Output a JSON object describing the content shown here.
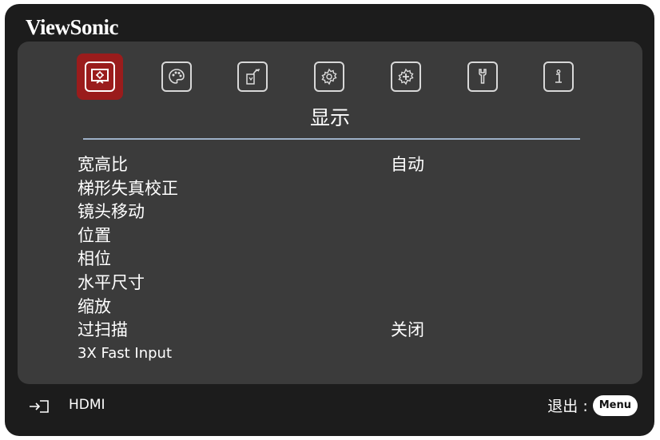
{
  "brand": "ViewSonic",
  "tabs": [
    {
      "icon": "display-icon",
      "selected": true
    },
    {
      "icon": "picture-palette-icon",
      "selected": false
    },
    {
      "icon": "power-management-icon",
      "selected": false
    },
    {
      "icon": "basic-settings-icon",
      "selected": false
    },
    {
      "icon": "advanced-settings-icon",
      "selected": false
    },
    {
      "icon": "system-wrench-icon",
      "selected": false
    },
    {
      "icon": "information-icon",
      "selected": false
    }
  ],
  "active_tab_title": "显示",
  "menu": {
    "items": [
      {
        "label": "宽高比",
        "value": "自动"
      },
      {
        "label": "梯形失真校正",
        "value": ""
      },
      {
        "label": "镜头移动",
        "value": ""
      },
      {
        "label": "位置",
        "value": ""
      },
      {
        "label": "相位",
        "value": ""
      },
      {
        "label": "水平尺寸",
        "value": ""
      },
      {
        "label": "缩放",
        "value": ""
      },
      {
        "label": "过扫描",
        "value": "关闭"
      },
      {
        "label": "3X Fast Input",
        "value": ""
      }
    ]
  },
  "footer": {
    "source_label": "HDMI",
    "exit_label": "退出 :",
    "menu_button_label": "Menu"
  },
  "colors": {
    "accent": "#9a1c1c",
    "panel": "#3b3b3b",
    "frame": "#1c1c1c",
    "divider": "#9db0c8"
  }
}
